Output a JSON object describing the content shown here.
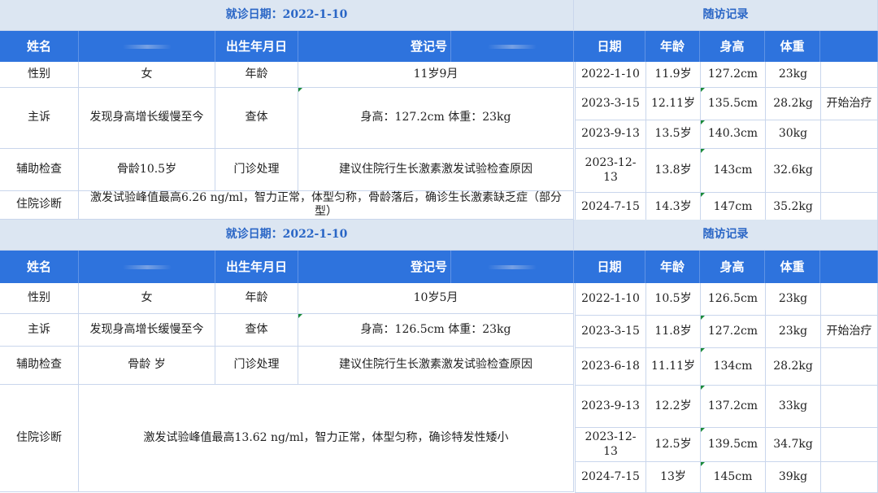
{
  "records": [
    {
      "visit_date_label": "就诊日期：2022-1-10",
      "followup_label": "随访记录",
      "headers": {
        "name": "姓名",
        "birth": "出生年月日",
        "reg": "登记号",
        "date": "日期",
        "age": "年龄",
        "height": "身高",
        "weight": "体重"
      },
      "rows": {
        "gender_label": "性别",
        "gender": "女",
        "age_label": "年龄",
        "age": "11岁9月",
        "complaint_label": "主诉",
        "complaint": "发现身高增长缓慢至今",
        "exam_label": "查体",
        "exam": "身高：127.2cm 体重：23kg",
        "aux_label": "辅助检查",
        "aux": "骨龄10.5岁",
        "clinic_label": "门诊处理",
        "clinic": "建议住院行生长激素激发试验检查原因",
        "diag_label": "住院诊断",
        "diag": "激发试验峰值最高6.26 ng/ml，智力正常，体型匀称，骨龄落后，确诊生长激素缺乏症（部分型）"
      },
      "followups": [
        {
          "date": "2022-1-10",
          "age": "11.9岁",
          "height": "127.2cm",
          "weight": "23kg",
          "note": ""
        },
        {
          "date": "2023-3-15",
          "age": "12.11岁",
          "height": "135.5cm",
          "weight": "28.2kg",
          "note": "开始治疗"
        },
        {
          "date": "2023-9-13",
          "age": "13.5岁",
          "height": "140.3cm",
          "weight": "30kg",
          "note": ""
        },
        {
          "date": "2023-12-13",
          "age": "13.8岁",
          "height": "143cm",
          "weight": "32.6kg",
          "note": ""
        },
        {
          "date": "2024-7-15",
          "age": "14.3岁",
          "height": "147cm",
          "weight": "35.2kg",
          "note": ""
        }
      ]
    },
    {
      "visit_date_label": "就诊日期：2022-1-10",
      "followup_label": "随访记录",
      "headers": {
        "name": "姓名",
        "birth": "出生年月日",
        "reg": "登记号",
        "date": "日期",
        "age": "年龄",
        "height": "身高",
        "weight": "体重"
      },
      "rows": {
        "gender_label": "性别",
        "gender": "女",
        "age_label": "年龄",
        "age": "10岁5月",
        "complaint_label": "主诉",
        "complaint": "发现身高增长缓慢至今",
        "exam_label": "查体",
        "exam": "身高：126.5cm 体重：23kg",
        "aux_label": "辅助检查",
        "aux": "骨龄  岁",
        "clinic_label": "门诊处理",
        "clinic": "建议住院行生长激素激发试验检查原因",
        "diag_label": "住院诊断",
        "diag": "激发试验峰值最高13.62 ng/ml，智力正常，体型匀称，确诊特发性矮小"
      },
      "followups": [
        {
          "date": "2022-1-10",
          "age": "10.5岁",
          "height": "126.5cm",
          "weight": "23kg",
          "note": ""
        },
        {
          "date": "2023-3-15",
          "age": "11.8岁",
          "height": "127.2cm",
          "weight": "23kg",
          "note": "开始治疗"
        },
        {
          "date": "2023-6-18",
          "age": "11.11岁",
          "height": "134cm",
          "weight": "28.2kg",
          "note": ""
        },
        {
          "date": "2023-9-13",
          "age": "12.2岁",
          "height": "137.2cm",
          "weight": "33kg",
          "note": ""
        },
        {
          "date": "2023-12-13",
          "age": "12.5岁",
          "height": "139.5cm",
          "weight": "34.7kg",
          "note": ""
        },
        {
          "date": "2024-7-15",
          "age": "13岁",
          "height": "145cm",
          "weight": "39kg",
          "note": ""
        }
      ]
    }
  ]
}
